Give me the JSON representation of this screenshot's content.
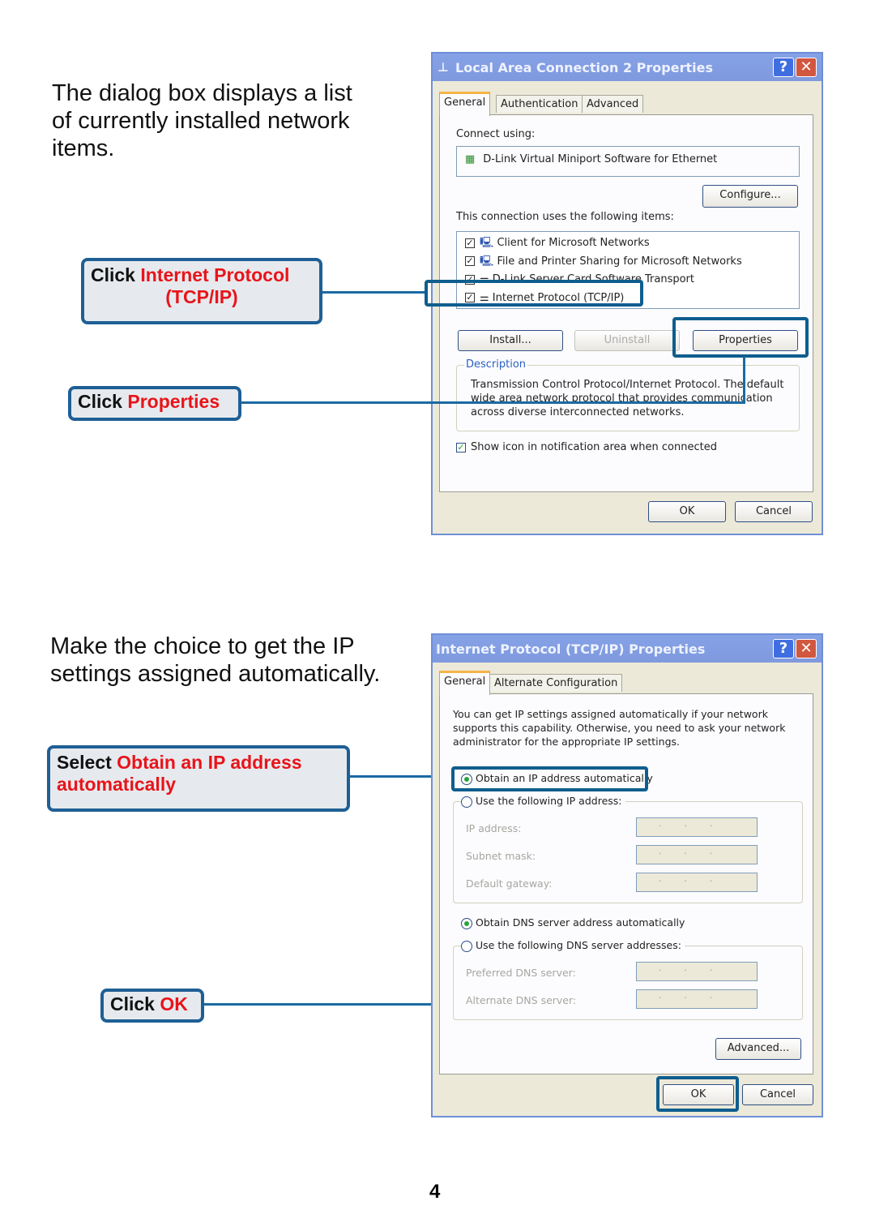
{
  "section1": {
    "intro": [
      "The dialog box displays a list",
      "of currently installed network",
      "items."
    ],
    "callout_tcp": {
      "prefix": "Click ",
      "highlight": "Internet Protocol",
      "line2": "(TCP/IP)"
    },
    "callout_props": {
      "prefix": "Click ",
      "highlight": "Properties"
    }
  },
  "dialog1": {
    "title": "Local Area Connection 2 Properties",
    "tabs": [
      "General",
      "Authentication",
      "Advanced"
    ],
    "connect_using_label": "Connect using:",
    "adapter": "D-Link Virtual Miniport Software for Ethernet",
    "configure": "Configure...",
    "items_label": "This connection uses the following items:",
    "items": [
      {
        "label": "Client for Microsoft Networks",
        "checked": true
      },
      {
        "label": "File and Printer Sharing for Microsoft Networks",
        "checked": true
      },
      {
        "label": "D-Link Server Card Software Transport",
        "checked": true
      },
      {
        "label": "Internet Protocol (TCP/IP)",
        "checked": true
      }
    ],
    "install": "Install...",
    "uninstall": "Uninstall",
    "properties": "Properties",
    "description_label": "Description",
    "description": "Transmission Control Protocol/Internet Protocol. The default wide area network protocol that provides communication across diverse interconnected networks.",
    "show_icon": "Show icon in notification area when connected",
    "show_icon_checked": true,
    "ok": "OK",
    "cancel": "Cancel"
  },
  "section2": {
    "intro": [
      "Make the choice to get the IP",
      "settings assigned automatically."
    ],
    "callout_obtain": {
      "prefix": "Select ",
      "highlight": "Obtain an IP address automatically"
    },
    "callout_ok": {
      "prefix": "Click ",
      "highlight": "OK"
    }
  },
  "dialog2": {
    "title": "Internet Protocol (TCP/IP) Properties",
    "tabs": [
      "General",
      "Alternate Configuration"
    ],
    "info": "You can get IP settings assigned automatically if your network supports this capability. Otherwise, you need to ask your network administrator for the appropriate IP settings.",
    "obtain_ip": "Obtain an IP address automatically",
    "use_ip": "Use the following IP address:",
    "ip_address": "IP address:",
    "subnet": "Subnet mask:",
    "gateway": "Default gateway:",
    "obtain_dns": "Obtain DNS server address automatically",
    "use_dns": "Use the following DNS server addresses:",
    "preferred_dns": "Preferred DNS server:",
    "alternate_dns": "Alternate DNS server:",
    "field_dots": "...",
    "advanced": "Advanced...",
    "ok": "OK",
    "cancel": "Cancel"
  },
  "page_number": "4",
  "colors": {
    "callout_border": "#1f5f95",
    "leader_line": "#1a6aa3",
    "highlight_red": "#e8141a",
    "titlebar": "#7f99de"
  }
}
